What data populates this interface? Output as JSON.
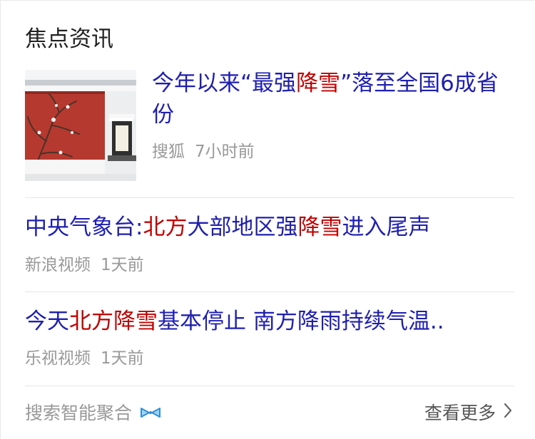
{
  "section_title": "焦点资讯",
  "featured": {
    "title_parts": [
      {
        "text": "今年以来“最强",
        "hl": false
      },
      {
        "text": "降雪",
        "hl": true
      },
      {
        "text": "”落至全国6成省份",
        "hl": false
      }
    ],
    "source": "搜狐",
    "time": "7小时前",
    "thumbnail": "snow-courtyard-photo"
  },
  "items": [
    {
      "title_parts": [
        {
          "text": "中央气象台:",
          "hl": false
        },
        {
          "text": "北方",
          "hl": true
        },
        {
          "text": "大部地区强",
          "hl": false
        },
        {
          "text": "降雪",
          "hl": true
        },
        {
          "text": "进入尾声",
          "hl": false
        }
      ],
      "source": "新浪视频",
      "time": "1天前"
    },
    {
      "title_parts": [
        {
          "text": "今天",
          "hl": false
        },
        {
          "text": "北方降雪",
          "hl": true
        },
        {
          "text": "基本停止 南方降雨持续气温..",
          "hl": false
        }
      ],
      "source": "乐视视频",
      "time": "1天前"
    }
  ],
  "footer": {
    "left_label": "搜索智能聚合",
    "left_icon": "bowtie-icon",
    "more_label": "查看更多",
    "more_icon": "chevron-right-icon"
  },
  "colors": {
    "link": "#1f1fb0",
    "highlight": "#c00000",
    "meta": "#999999"
  }
}
